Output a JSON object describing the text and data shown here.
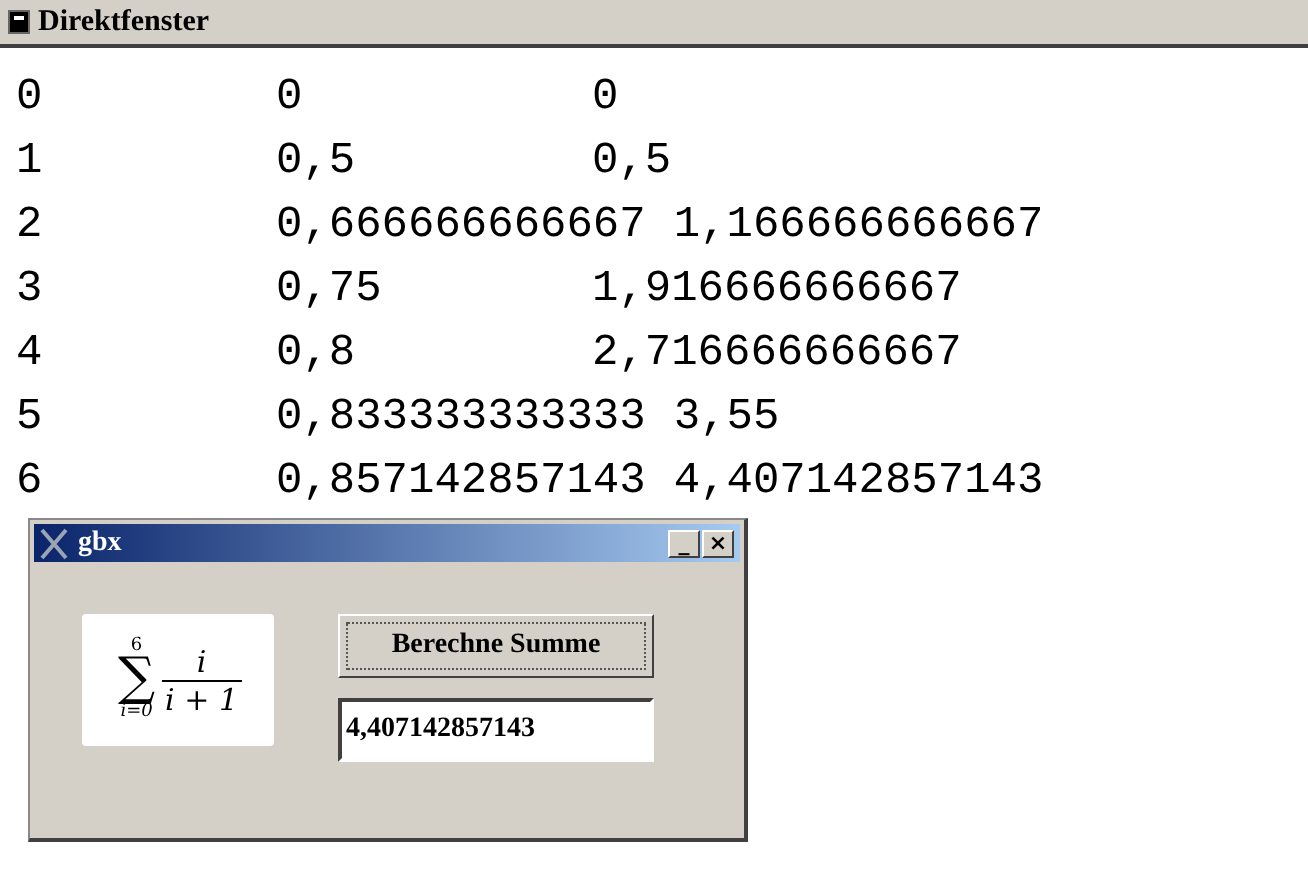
{
  "window": {
    "title": "Direktfenster"
  },
  "output_rows": [
    {
      "cells": [
        "0",
        "0",
        "0"
      ]
    },
    {
      "cells": [
        "1",
        "0,5",
        "0,5"
      ]
    },
    {
      "cells": [
        "2",
        "0,666666666667",
        "1,166666666667"
      ]
    },
    {
      "cells": [
        "3",
        "0,75",
        "1,916666666667"
      ]
    },
    {
      "cells": [
        "4",
        "0,8",
        "2,716666666667"
      ]
    },
    {
      "cells": [
        "5",
        "0,833333333333",
        "3,55"
      ]
    },
    {
      "cells": [
        "6",
        "0,857142857143",
        "4,407142857143"
      ]
    }
  ],
  "dialog": {
    "title": "gbx",
    "controls": [
      "_",
      "×"
    ],
    "formula": {
      "symbol": "∑",
      "upper": "6",
      "lower": "i=0",
      "numerator": "i",
      "denominator": "i + 1"
    },
    "button": "Berechne Summe",
    "result": "4,407142857143"
  }
}
